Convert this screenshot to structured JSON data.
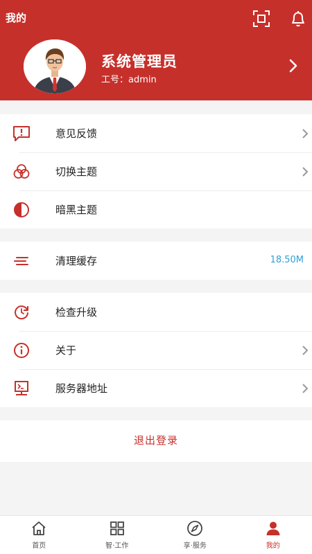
{
  "header": {
    "title": "我的",
    "scan_icon": "scan-icon",
    "bell_icon": "bell-icon",
    "background": "#c6302b"
  },
  "profile": {
    "name": "系统管理员",
    "id_text": "工号：admin"
  },
  "menu": {
    "feedback": "意见反馈",
    "switch_theme": "切换主题",
    "dark_theme": "暗黑主题",
    "clear_cache": "清理缓存",
    "cache_size": "18.50M",
    "check_upgrade": "检查升级",
    "about": "关于",
    "server_address": "服务器地址"
  },
  "logout_label": "退出登录",
  "tabs": [
    {
      "label": "首页",
      "icon": "home-icon"
    },
    {
      "label": "智·工作",
      "icon": "grid-icon"
    },
    {
      "label": "享·服务",
      "icon": "compass-icon"
    },
    {
      "label": "我的",
      "icon": "user-icon",
      "active": true
    }
  ],
  "colors": {
    "accent": "#c6302b",
    "value": "#2ea0d9"
  }
}
